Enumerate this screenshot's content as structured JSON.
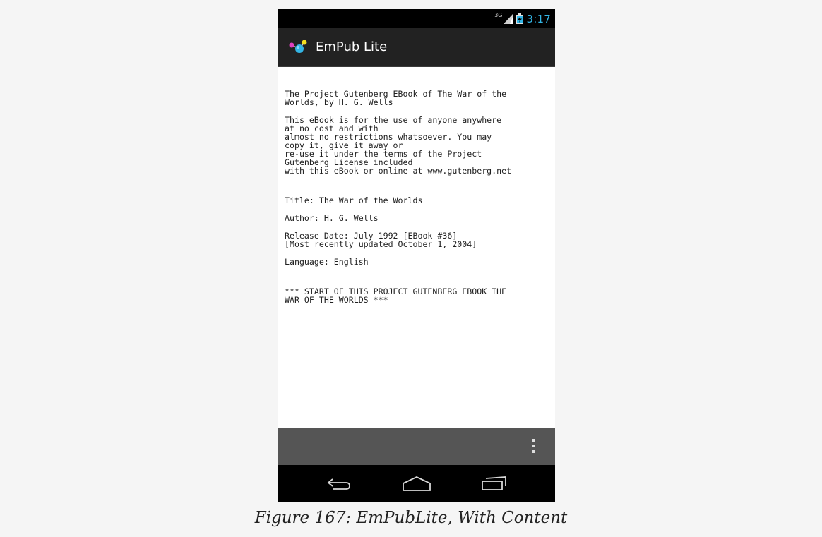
{
  "status_bar": {
    "network_type": "3G",
    "time": "3:17",
    "icons": [
      "signal-icon",
      "battery-charging-icon"
    ],
    "time_color": "#33b5e5"
  },
  "action_bar": {
    "app_icon": "empub-app-icon",
    "title": "EmPub Lite"
  },
  "content": {
    "paragraphs": [
      "The Project Gutenberg EBook of The War of the\nWorlds, by H. G. Wells",
      "This eBook is for the use of anyone anywhere\nat no cost and with\nalmost no restrictions whatsoever. You may\ncopy it, give it away or\nre-use it under the terms of the Project\nGutenberg License included\nwith this eBook or online at www.gutenberg.net",
      "Title: The War of the Worlds",
      "Author: H. G. Wells",
      "Release Date: July 1992 [EBook #36]\n[Most recently updated October 1, 2004]",
      "Language: English",
      "*** START OF THIS PROJECT GUTENBERG EBOOK THE\nWAR OF THE WORLDS ***"
    ]
  },
  "bottom_bar": {
    "overflow_icon": "overflow-menu-icon"
  },
  "nav_bar": {
    "buttons": [
      "back-icon",
      "home-icon",
      "recent-apps-icon"
    ]
  },
  "caption": "Figure 167: EmPubLite, With Content"
}
